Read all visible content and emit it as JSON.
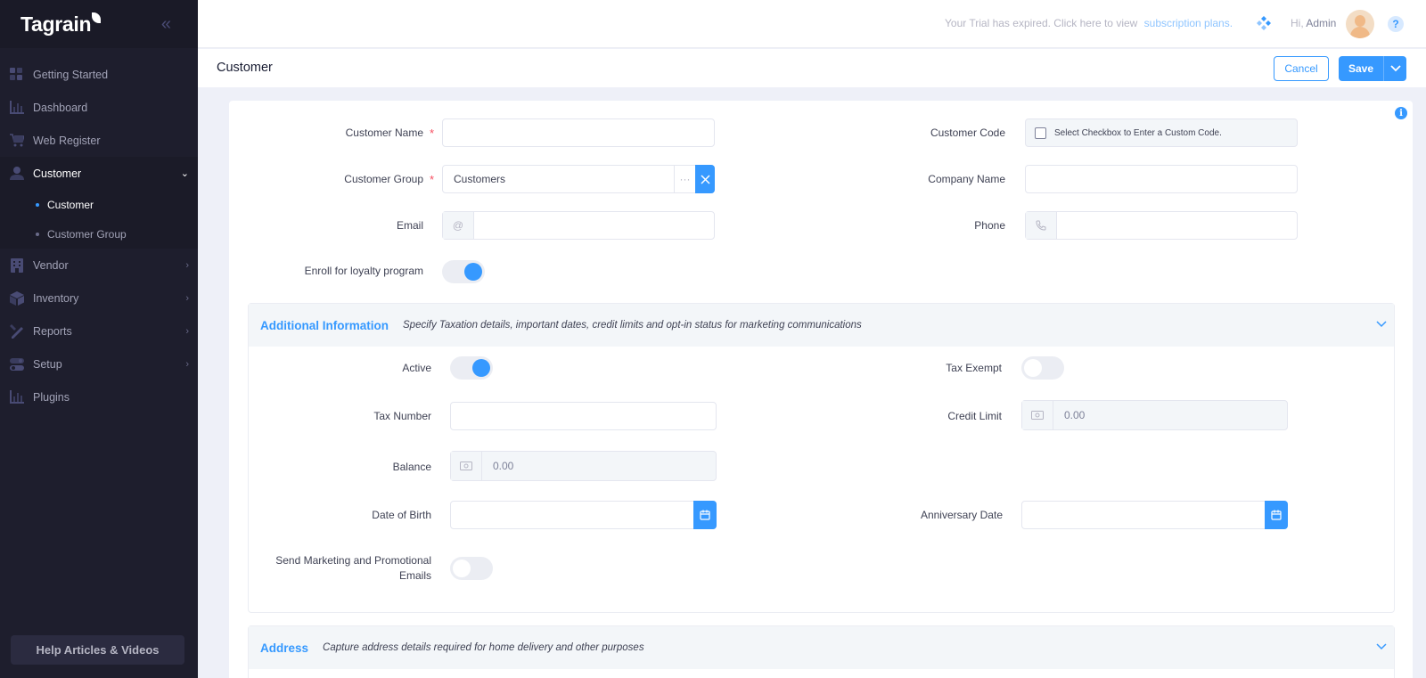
{
  "app": {
    "brand": "Tagrain"
  },
  "sidebar": {
    "items": [
      {
        "label": "Getting Started",
        "icon": "grid-icon"
      },
      {
        "label": "Dashboard",
        "icon": "bar-chart-icon"
      },
      {
        "label": "Web Register",
        "icon": "cart-icon"
      },
      {
        "label": "Customer",
        "icon": "user-icon",
        "active": true,
        "children": [
          {
            "label": "Customer",
            "active": true
          },
          {
            "label": "Customer Group"
          }
        ]
      },
      {
        "label": "Vendor",
        "icon": "building-icon"
      },
      {
        "label": "Inventory",
        "icon": "box-icon"
      },
      {
        "label": "Reports",
        "icon": "pencil-ruler-icon"
      },
      {
        "label": "Setup",
        "icon": "toggles-icon"
      },
      {
        "label": "Plugins",
        "icon": "bar-chart-icon"
      }
    ],
    "help_label": "Help Articles & Videos"
  },
  "topbar": {
    "trial_text": "Your Trial has expired. Click here to view",
    "trial_link": "subscription plans.",
    "greeting": "Hi,",
    "user": "Admin",
    "help_glyph": "?"
  },
  "header": {
    "title": "Customer",
    "cancel_label": "Cancel",
    "save_label": "Save"
  },
  "form": {
    "customer_name": {
      "label": "Customer Name",
      "value": ""
    },
    "customer_code": {
      "label": "Customer Code",
      "checkbox_text": "Select Checkbox to Enter a Custom Code."
    },
    "customer_group": {
      "label": "Customer Group",
      "value": "Customers",
      "more_glyph": "···"
    },
    "company_name": {
      "label": "Company Name",
      "value": ""
    },
    "email": {
      "label": "Email",
      "addon_glyph": "@",
      "value": ""
    },
    "phone": {
      "label": "Phone",
      "value": ""
    },
    "loyalty": {
      "label": "Enroll for loyalty program",
      "on": true
    }
  },
  "additional": {
    "title": "Additional Information",
    "description": "Specify Taxation details, important dates, credit limits and opt-in status for marketing communications",
    "active": {
      "label": "Active",
      "on": true
    },
    "tax_exempt": {
      "label": "Tax Exempt",
      "on": false
    },
    "tax_number": {
      "label": "Tax Number",
      "value": ""
    },
    "credit_limit": {
      "label": "Credit Limit",
      "value": "0.00"
    },
    "balance": {
      "label": "Balance",
      "value": "0.00"
    },
    "dob": {
      "label": "Date of Birth",
      "value": ""
    },
    "anniversary": {
      "label": "Anniversary Date",
      "value": ""
    },
    "marketing": {
      "label_line1": "Send Marketing and Promotional",
      "label_line2": "Emails",
      "on": false
    }
  },
  "address": {
    "title": "Address",
    "description": "Capture address details required for home delivery and other purposes"
  },
  "colors": {
    "primary": "#3699ff",
    "sidebar": "#1e1e2d",
    "required": "#f64e60"
  }
}
